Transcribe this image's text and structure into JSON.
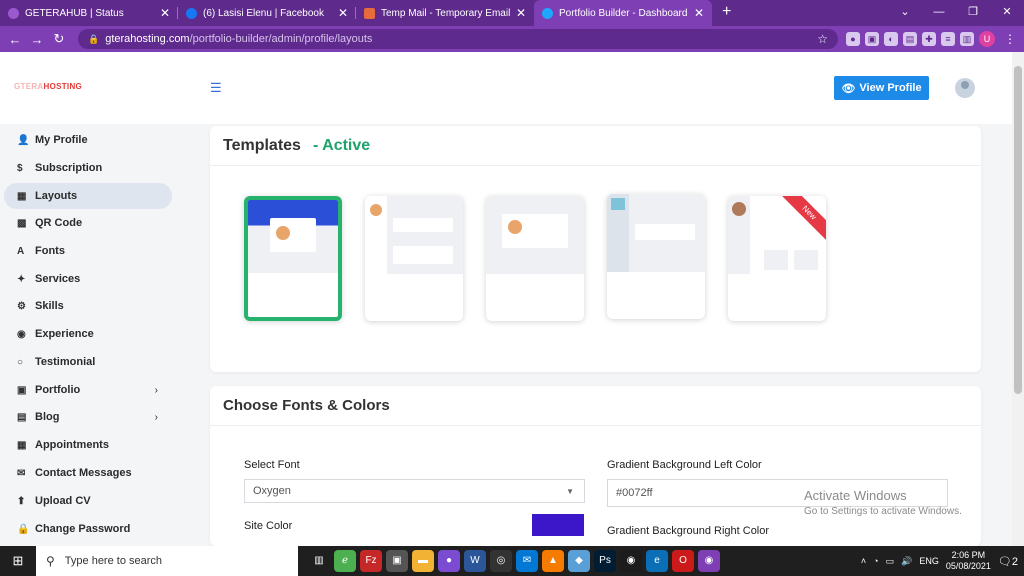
{
  "browser": {
    "tabs": [
      {
        "label": "GETERAHUB | Status",
        "icon_color": "#5e2a8c"
      },
      {
        "label": "(6) Lasisi Elenu | Facebook",
        "icon_color": "#1877f2"
      },
      {
        "label": "Temp Mail - Temporary Email",
        "icon_color": "#e66a3a"
      },
      {
        "label": "Portfolio Builder - Dashboard",
        "icon_color": "#1ea7fd"
      }
    ],
    "new_tab": "+",
    "url_host": "gterahosting.com",
    "url_path": "/portfolio-builder/admin/profile/layouts",
    "profile_initial": "U"
  },
  "app": {
    "logo_prefix": "GTERA",
    "logo_text": "HOSTING",
    "view_profile_label": "View Profile"
  },
  "sidebar": {
    "items": [
      {
        "label": "My Profile",
        "icon": "person-icon",
        "glyph": "👤"
      },
      {
        "label": "Subscription",
        "icon": "dollar-icon",
        "glyph": "$"
      },
      {
        "label": "Layouts",
        "icon": "layout-icon",
        "glyph": "▦"
      },
      {
        "label": "QR Code",
        "icon": "qr-icon",
        "glyph": "▩"
      },
      {
        "label": "Fonts",
        "icon": "font-icon",
        "glyph": "A"
      },
      {
        "label": "Services",
        "icon": "wrench-icon",
        "glyph": "✦"
      },
      {
        "label": "Skills",
        "icon": "cogs-icon",
        "glyph": "⚙"
      },
      {
        "label": "Experience",
        "icon": "briefcase-icon",
        "glyph": "◉"
      },
      {
        "label": "Testimonial",
        "icon": "comment-icon",
        "glyph": "○"
      },
      {
        "label": "Portfolio",
        "icon": "portfolio-icon",
        "glyph": "▣"
      },
      {
        "label": "Blog",
        "icon": "blog-icon",
        "glyph": "▤"
      },
      {
        "label": "Appointments",
        "icon": "calendar-icon",
        "glyph": "▦"
      },
      {
        "label": "Contact Messages",
        "icon": "envelope-icon",
        "glyph": "✉"
      },
      {
        "label": "Upload CV",
        "icon": "upload-icon",
        "glyph": "⬆"
      },
      {
        "label": "Change Password",
        "icon": "lock-icon",
        "glyph": "🔒"
      }
    ],
    "active_index": 2
  },
  "templates_card": {
    "title": "Templates",
    "status": "- Active",
    "templates": [
      {
        "name": "template-1",
        "selected": true
      },
      {
        "name": "template-2"
      },
      {
        "name": "template-3"
      },
      {
        "name": "template-4"
      },
      {
        "name": "template-5",
        "badge": "New"
      }
    ]
  },
  "fonts_card": {
    "title": "Choose Fonts & Colors",
    "select_font_label": "Select Font",
    "select_font_value": "Oxygen",
    "site_color_label": "Site Color",
    "site_color_value": "#3b17c9",
    "grad_left_label": "Gradient Background Left Color",
    "grad_left_value": "#0072ff",
    "grad_right_label": "Gradient Background Right Color"
  },
  "watermark": {
    "title": "Activate Windows",
    "sub": "Go to Settings to activate Windows."
  },
  "taskbar": {
    "search_placeholder": "Type here to search",
    "lang": "ENG",
    "time": "2:06 PM",
    "date": "05/08/2021",
    "notifications": "2"
  },
  "colors": {
    "accent": "#1e8ae8",
    "active_green": "#20a26b",
    "browser_purple": "#7d3fb3"
  }
}
